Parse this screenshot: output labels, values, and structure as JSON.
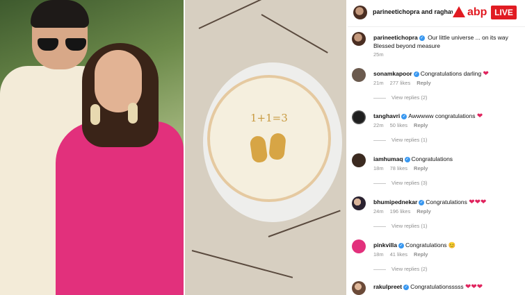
{
  "header": {
    "title": "parineetichopra and raghavchadha",
    "brand": "abp",
    "live": "LIVE"
  },
  "post": {
    "username": "parineetichopra",
    "caption": "Our little universe ... on its way",
    "caption_line2": "Blessed beyond measure",
    "time": "25m"
  },
  "cake_text": "1+1=3",
  "comments": [
    {
      "username": "sonamkapoor",
      "text": "Congratulations darling",
      "hearts": "❤",
      "time": "21m",
      "likes": "277 likes",
      "reply": "Reply",
      "view": "View replies (2)"
    },
    {
      "username": "tanghavri",
      "text": "Awwwww congratulations",
      "hearts": "❤",
      "time": "22m",
      "likes": "50 likes",
      "reply": "Reply",
      "view": "View replies (1)"
    },
    {
      "username": "iamhumaq",
      "text": "Congratulations",
      "hearts": "",
      "time": "18m",
      "likes": "78 likes",
      "reply": "Reply",
      "view": "View replies (3)"
    },
    {
      "username": "bhumipednekar",
      "text": "Congratulations",
      "hearts": "❤❤❤",
      "time": "24m",
      "likes": "196 likes",
      "reply": "Reply",
      "view": "View replies (1)"
    },
    {
      "username": "pinkvilla",
      "text": "Congratulations 😊",
      "hearts": "",
      "time": "18m",
      "likes": "41 likes",
      "reply": "Reply",
      "view": "View replies (2)"
    },
    {
      "username": "rakulpreet",
      "text": "Congratulationsssss",
      "hearts": "❤❤❤",
      "time": "",
      "likes": "",
      "reply": "",
      "view": ""
    }
  ],
  "colors": {
    "accent": "#e11b22",
    "verified": "#3897f0",
    "heart": "#e0245e",
    "dress": "#e2307c"
  }
}
